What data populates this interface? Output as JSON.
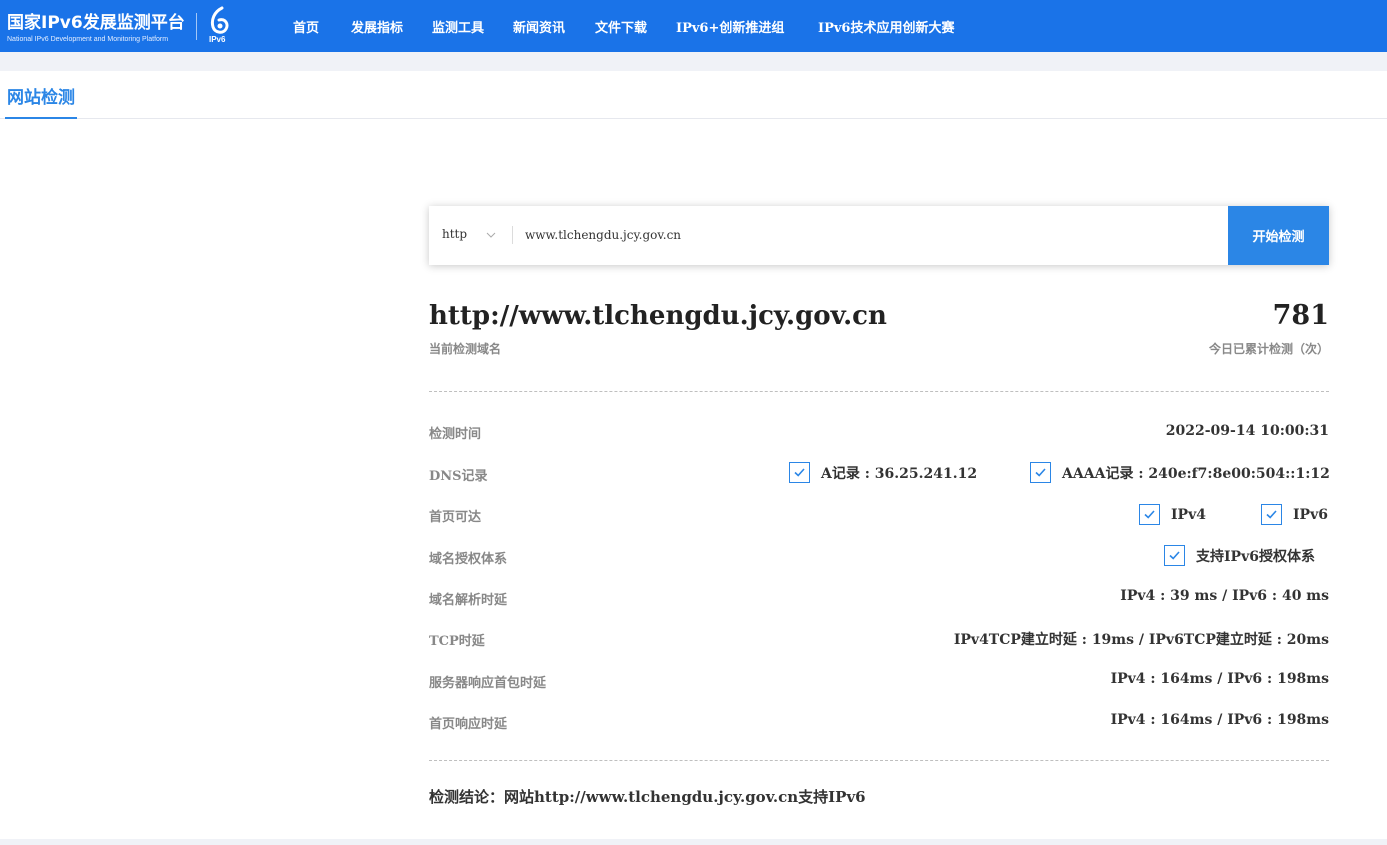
{
  "header": {
    "logo_cn": "国家IPv6发展监测平台",
    "logo_en": "National IPv6 Development and Monitoring Platform",
    "mark_text": "IPv6",
    "nav": [
      "首页",
      "发展指标",
      "监测工具",
      "新闻资讯",
      "文件下载",
      "IPv6+创新推进组",
      "IPv6技术应用创新大赛"
    ]
  },
  "tabs": {
    "active": "网站检测"
  },
  "search": {
    "protocol": "http",
    "value": "www.tlchengdu.jcy.gov.cn",
    "button": "开始检测"
  },
  "result": {
    "domain": "http://www.tlchengdu.jcy.gov.cn",
    "domain_caption": "当前检测域名",
    "count": "781",
    "count_caption": "今日已累计检测（次）",
    "rows": {
      "time_label": "检测时间",
      "time_value": "2022-09-14 10:00:31",
      "dns_label": "DNS记录",
      "dns_a": "A记录 : 36.25.241.12",
      "dns_aaaa": "AAAA记录 : 240e:f7:8e00:504::1:12",
      "home_label": "首页可达",
      "home_ipv4": "IPv4",
      "home_ipv6": "IPv6",
      "auth_label": "域名授权体系",
      "auth_value": "支持IPv6授权体系",
      "resolve_label": "域名解析时延",
      "resolve_value": "IPv4 : 39 ms / IPv6 : 40 ms",
      "tcp_label": "TCP时延",
      "tcp_value": "IPv4TCP建立时延 : 19ms / IPv6TCP建立时延 : 20ms",
      "server_label": "服务器响应首包时延",
      "server_value": "IPv4 : 164ms / IPv6 : 198ms",
      "page_label": "首页响应时延",
      "page_value": "IPv4 : 164ms / IPv6 : 198ms"
    },
    "conclusion": "检测结论：网站http://www.tlchengdu.jcy.gov.cn支持IPv6"
  },
  "colors": {
    "primary": "#1a73e8",
    "accent": "#2b86e6",
    "band": "#f0f2f7"
  },
  "icons": {
    "check": "checkbox-checked-icon",
    "chevron": "chevron-down-icon",
    "mark": "ipv6-logo-icon"
  }
}
